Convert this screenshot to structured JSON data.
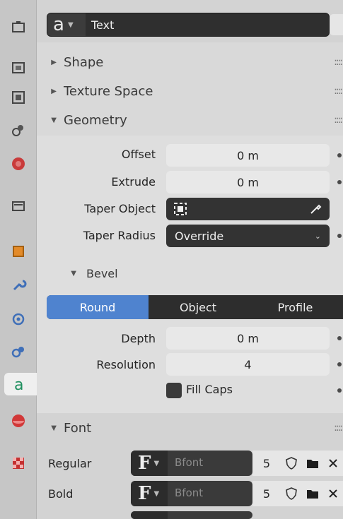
{
  "datablock": {
    "type_icon": "text-data-icon",
    "name": "Text"
  },
  "panels": {
    "shape": "Shape",
    "texture_space": "Texture Space",
    "geometry": "Geometry",
    "font": "Font"
  },
  "geometry": {
    "offset_label": "Offset",
    "offset_value": "0 m",
    "extrude_label": "Extrude",
    "extrude_value": "0 m",
    "taper_object_label": "Taper Object",
    "taper_radius_label": "Taper Radius",
    "taper_radius_value": "Override"
  },
  "bevel": {
    "title": "Bevel",
    "modes": [
      "Round",
      "Object",
      "Profile"
    ],
    "active_mode": "Round",
    "depth_label": "Depth",
    "depth_value": "0 m",
    "resolution_label": "Resolution",
    "resolution_value": "4",
    "fill_caps_label": "Fill Caps"
  },
  "font": {
    "rows": [
      {
        "label": "Regular",
        "font_name": "Bfont",
        "users": "5"
      },
      {
        "label": "Bold",
        "font_name": "Bfont",
        "users": "5"
      }
    ]
  },
  "colors": {
    "accent": "#4f83cf",
    "dark_field": "#333333"
  }
}
